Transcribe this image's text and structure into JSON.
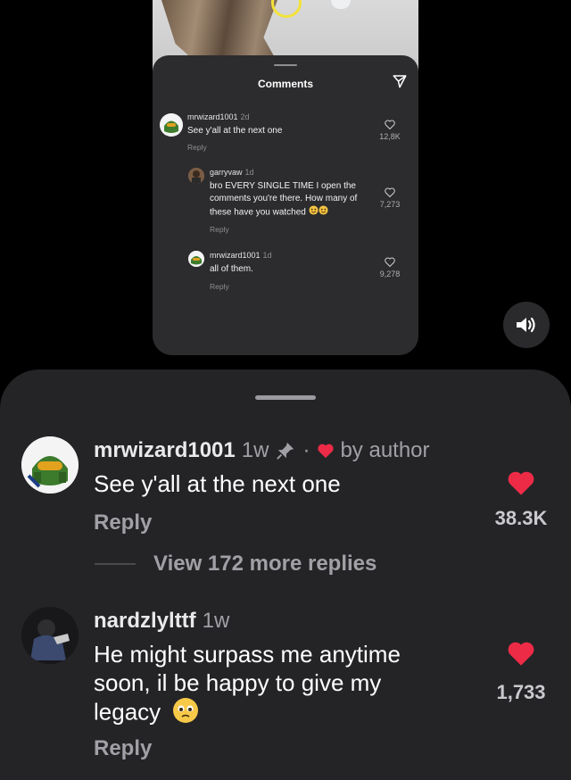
{
  "video": {
    "sheet_title": "Comments",
    "comments": [
      {
        "user": "mrwizard1001",
        "time": "2d",
        "text": "See y'all at the next one",
        "reply": "Reply",
        "likes": "12,8K"
      },
      {
        "user": "garryvaw",
        "time": "1d",
        "text": "bro EVERY SINGLE TIME I open the comments you're there. How many of these have you watched",
        "reply": "Reply",
        "likes": "7,273"
      },
      {
        "user": "mrwizard1001",
        "time": "1d",
        "text": "all of them.",
        "reply": "Reply",
        "likes": "9,278"
      }
    ]
  },
  "panel": {
    "comments": [
      {
        "user": "mrwizard1001",
        "time": "1w",
        "separator": "·",
        "author_badge": "by author",
        "text": "See y'all at the next one",
        "reply": "Reply",
        "likes": "38.3K",
        "liked": true
      },
      {
        "user": "nardzlylttf",
        "time": "1w",
        "text_line1": "He might surpass me anytime",
        "text_line2": "soon, il be happy to give my",
        "text_line3": "legacy",
        "reply": "Reply",
        "likes": "1,733",
        "liked": true
      }
    ],
    "view_more": "View 172 more replies"
  },
  "colors": {
    "like_red": "#ee2b47",
    "panel_bg": "#242427",
    "sheet_bg": "#2c2c2e"
  },
  "icons": [
    "send-icon",
    "heart-outline-icon",
    "heart-filled-icon",
    "pin-icon",
    "speaker-icon",
    "emoji-icon"
  ]
}
